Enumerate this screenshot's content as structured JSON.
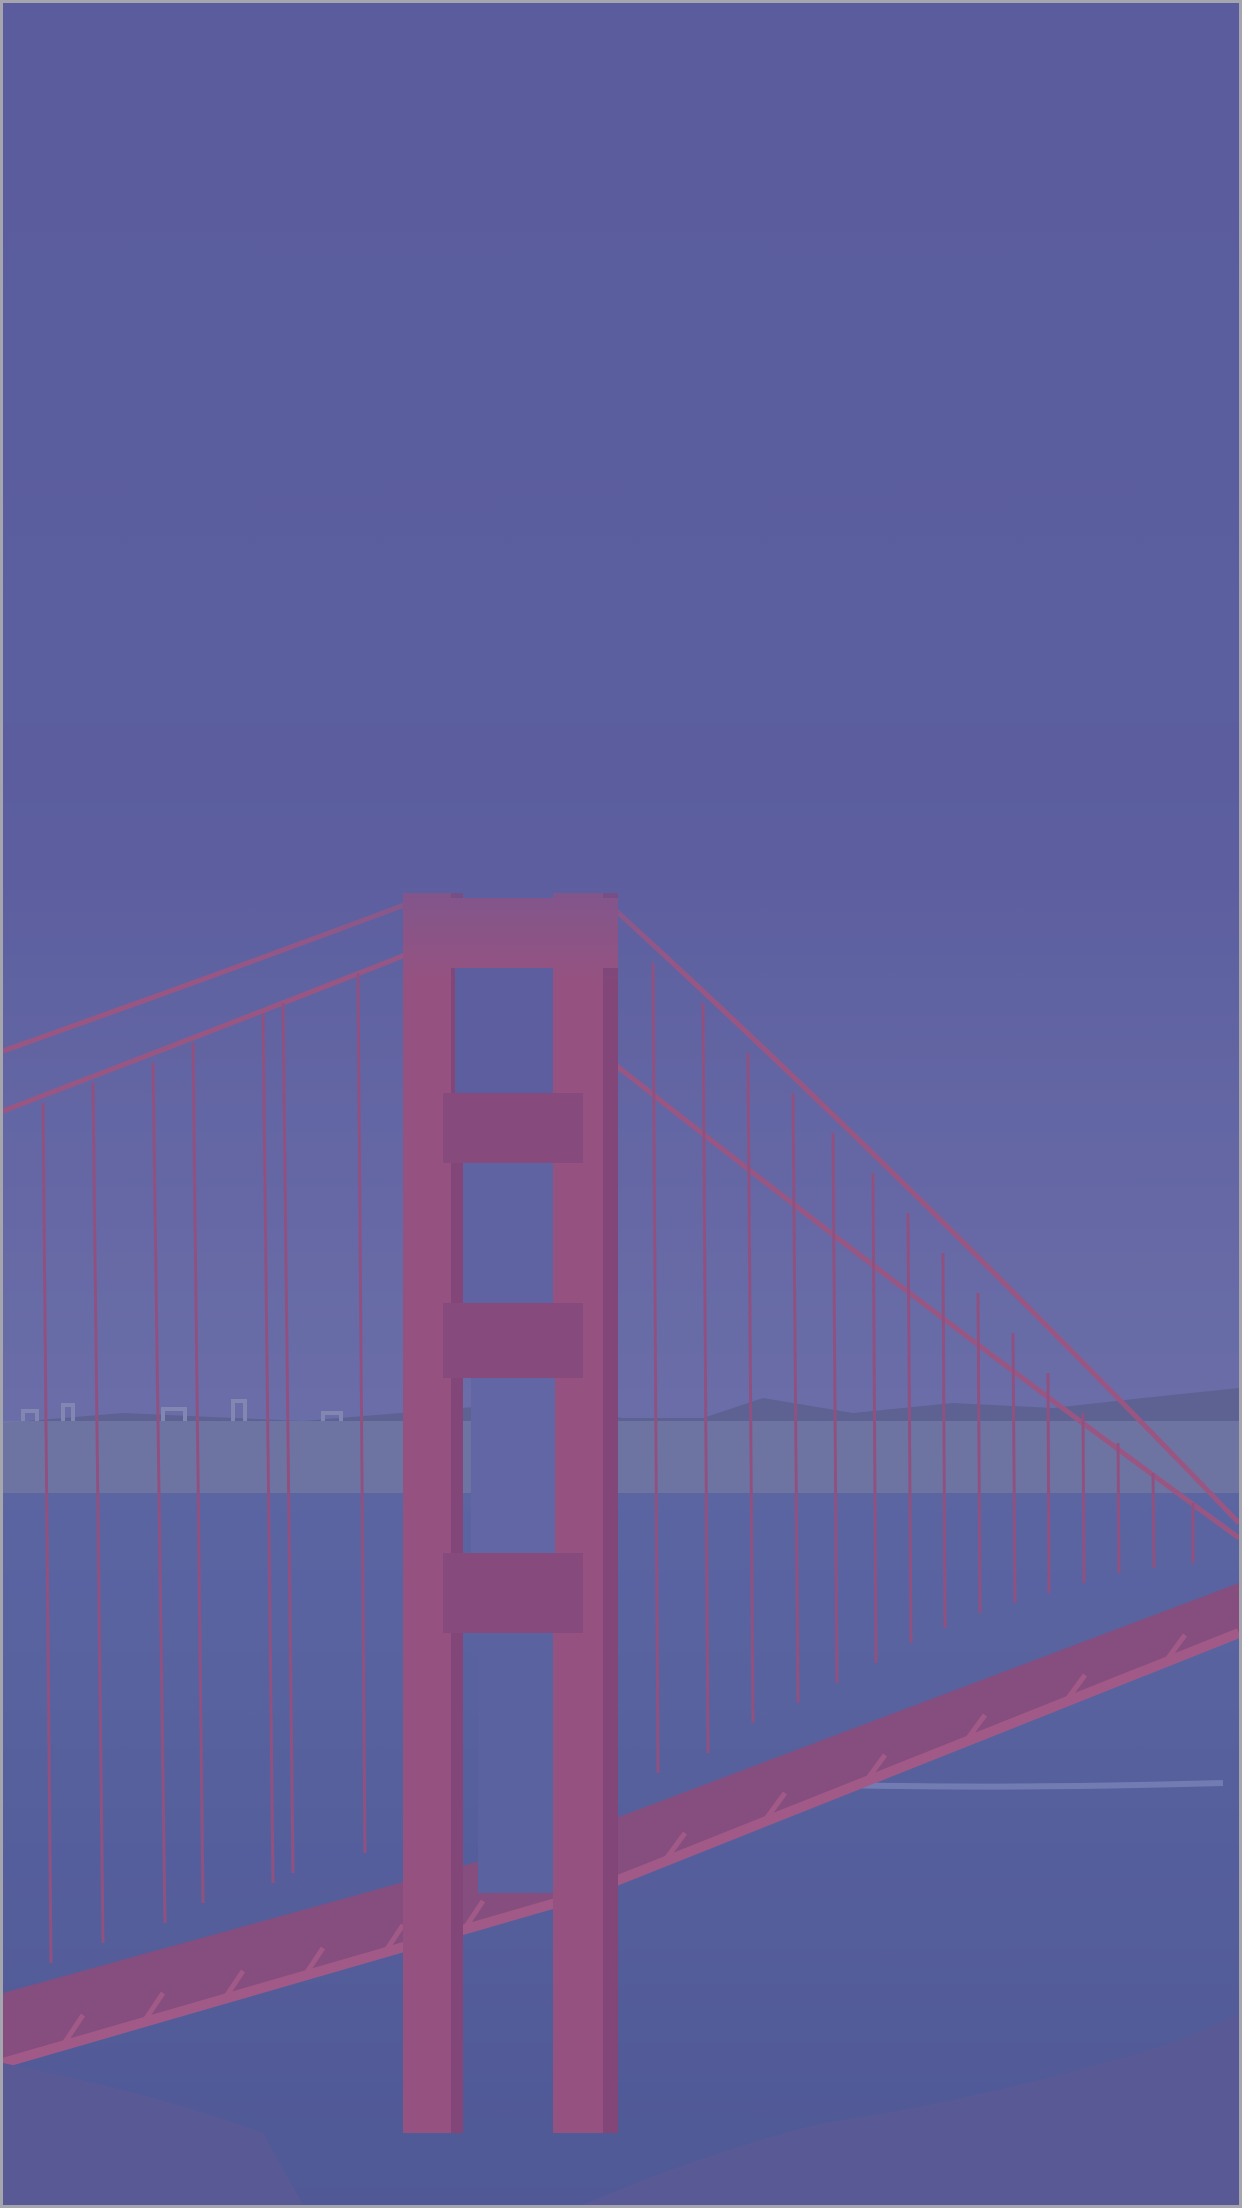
{
  "screen": {
    "kind": "fullscreen-background-image",
    "subject_icon": "suspension-bridge-photo",
    "colors": {
      "overlay_tint": "#5c5fa0",
      "sky_top": "#5a5c9e",
      "sky_bottom": "#6e72aa",
      "water": "#4f5d9a",
      "bridge_red": "#a2507a",
      "bridge_shadow": "#7c3f6c",
      "cable": "#a8557d",
      "hills": "#5d6390",
      "city": "#7a80a8",
      "frame_border": "#a5a5ad"
    }
  }
}
